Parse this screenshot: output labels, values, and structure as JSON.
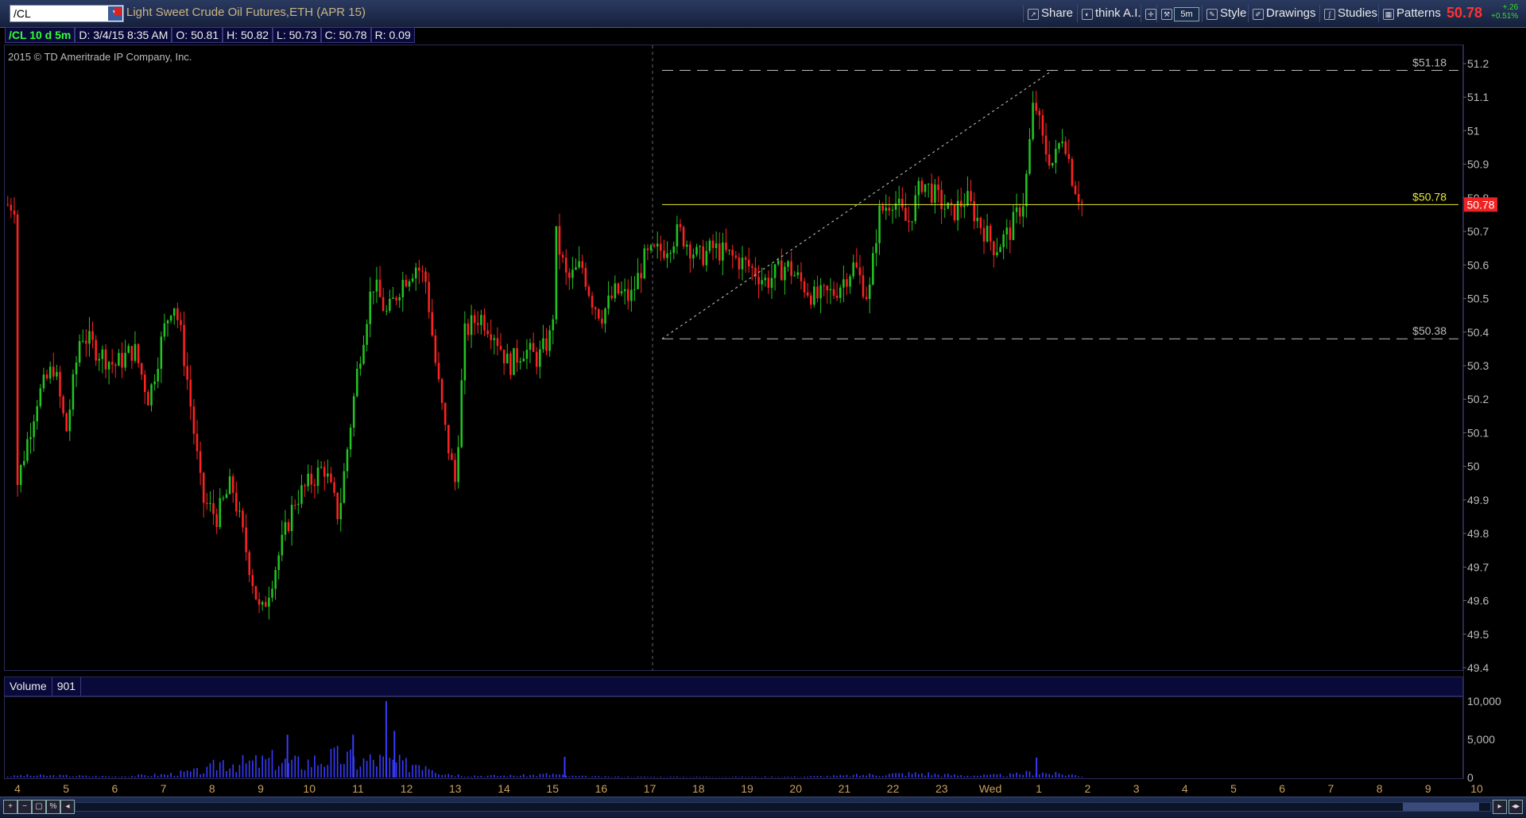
{
  "toolbar": {
    "symbol": "/CL",
    "title": "Light Sweet Crude Oil Futures,ETH (APR 15)",
    "share_label": "Share",
    "thinkai_label": "think A.I.",
    "interval_label": "5m",
    "style_label": "Style",
    "drawings_label": "Drawings",
    "studies_label": "Studies",
    "patterns_label": "Patterns",
    "last_price": "50.78",
    "change": "+.26",
    "change_pct": "+0.51%"
  },
  "info": {
    "symbol_period": "/CL 10 d 5m",
    "date": "D: 3/4/15 8:35 AM",
    "open": "O: 50.81",
    "high": "H: 50.82",
    "low": "L: 50.73",
    "close": "C: 50.78",
    "range": "R: 0.09"
  },
  "copyright": "2015 © TD Ameritrade IP Company, Inc.",
  "volume_pane": {
    "label": "Volume",
    "value": "901"
  },
  "colors": {
    "up": "#22c422",
    "down": "#ff2222",
    "volume": "#3a3aff",
    "level_line": "#e8e832",
    "dash_line": "#bbbbbb",
    "price_tag_bg": "#ee2222"
  },
  "chart_data": {
    "type": "candlestick",
    "price_axis": {
      "ticks": [
        "51.2",
        "51.1",
        "51",
        "50.9",
        "50.8",
        "50.7",
        "50.6",
        "50.5",
        "50.4",
        "50.3",
        "50.2",
        "50.1",
        "50",
        "49.9",
        "49.8",
        "49.7",
        "49.6",
        "49.5",
        "49.4"
      ],
      "ylim": [
        49.4,
        51.2
      ]
    },
    "volume_axis": {
      "ticks": [
        "10,000",
        "5,000",
        "0"
      ],
      "ylim": [
        0,
        10000
      ]
    },
    "x_labels": [
      "4",
      "5",
      "6",
      "7",
      "8",
      "9",
      "10",
      "11",
      "12",
      "13",
      "14",
      "15",
      "16",
      "17",
      "18",
      "19",
      "20",
      "21",
      "22",
      "23",
      "Wed",
      "1",
      "2",
      "3",
      "4",
      "5",
      "6",
      "7",
      "8",
      "9",
      "10"
    ],
    "levels": [
      {
        "label": "$51.18",
        "value": 51.18,
        "style": "dashed"
      },
      {
        "label": "$50.78",
        "value": 50.78,
        "style": "solid"
      },
      {
        "label": "$50.38",
        "value": 50.38,
        "style": "dashed"
      }
    ],
    "current_price_tag": "50.78",
    "trendline": {
      "from_value": 50.38,
      "to_value": 51.18
    },
    "close_anchors": [
      [
        0,
        49.95
      ],
      [
        0.4,
        50.2
      ],
      [
        0.75,
        50.3
      ],
      [
        1.0,
        50.1
      ],
      [
        1.3,
        50.4
      ],
      [
        1.6,
        50.35
      ],
      [
        2.0,
        50.3
      ],
      [
        2.4,
        50.35
      ],
      [
        2.7,
        50.2
      ],
      [
        3.0,
        50.4
      ],
      [
        3.2,
        50.5
      ],
      [
        3.35,
        50.4
      ],
      [
        3.5,
        50.25
      ],
      [
        3.8,
        49.9
      ],
      [
        4.1,
        49.85
      ],
      [
        4.4,
        49.95
      ],
      [
        4.7,
        49.75
      ],
      [
        5.0,
        49.55
      ],
      [
        5.3,
        49.7
      ],
      [
        5.7,
        49.9
      ],
      [
        6.0,
        49.95
      ],
      [
        6.3,
        50.0
      ],
      [
        6.6,
        49.85
      ],
      [
        7.0,
        50.3
      ],
      [
        7.3,
        50.55
      ],
      [
        7.6,
        50.45
      ],
      [
        7.9,
        50.55
      ],
      [
        8.2,
        50.6
      ],
      [
        8.4,
        50.55
      ],
      [
        8.6,
        50.3
      ],
      [
        8.8,
        50.1
      ],
      [
        9.0,
        49.95
      ],
      [
        9.2,
        50.4
      ],
      [
        9.5,
        50.45
      ],
      [
        9.8,
        50.4
      ],
      [
        10.1,
        50.3
      ],
      [
        10.4,
        50.35
      ],
      [
        10.7,
        50.32
      ],
      [
        11.0,
        50.4
      ],
      [
        11.05,
        50.7
      ],
      [
        11.3,
        50.55
      ],
      [
        11.6,
        50.6
      ],
      [
        11.8,
        50.5
      ],
      [
        12.0,
        50.45
      ],
      [
        12.3,
        50.52
      ],
      [
        12.6,
        50.5
      ],
      [
        12.9,
        50.62
      ],
      [
        13.3,
        50.65
      ],
      [
        13.6,
        50.7
      ],
      [
        14.0,
        50.62
      ],
      [
        14.3,
        50.65
      ],
      [
        14.6,
        50.63
      ],
      [
        15.0,
        50.6
      ],
      [
        15.4,
        50.55
      ],
      [
        15.8,
        50.6
      ],
      [
        16.1,
        50.55
      ],
      [
        16.4,
        50.5
      ],
      [
        16.8,
        50.52
      ],
      [
        17.2,
        50.6
      ],
      [
        17.5,
        50.5
      ],
      [
        17.7,
        50.75
      ],
      [
        18.0,
        50.8
      ],
      [
        18.3,
        50.72
      ],
      [
        18.6,
        50.85
      ],
      [
        18.9,
        50.8
      ],
      [
        19.2,
        50.75
      ],
      [
        19.5,
        50.8
      ],
      [
        19.8,
        50.72
      ],
      [
        20.1,
        50.65
      ],
      [
        20.4,
        50.7
      ],
      [
        20.7,
        50.8
      ],
      [
        20.9,
        51.1
      ],
      [
        21.1,
        50.95
      ],
      [
        21.3,
        50.9
      ],
      [
        21.5,
        51.0
      ],
      [
        21.7,
        50.85
      ],
      [
        21.9,
        50.78
      ]
    ],
    "volume_anchors": [
      [
        0,
        300
      ],
      [
        1,
        250
      ],
      [
        2,
        150
      ],
      [
        3,
        400
      ],
      [
        3.9,
        1000
      ],
      [
        4.2,
        2400
      ],
      [
        4.6,
        2000
      ],
      [
        5.0,
        2200
      ],
      [
        5.3,
        2600
      ],
      [
        5.6,
        2000
      ],
      [
        6.0,
        2300
      ],
      [
        6.4,
        2800
      ],
      [
        6.7,
        3000
      ],
      [
        7.0,
        2200
      ],
      [
        7.3,
        2600
      ],
      [
        7.6,
        2400
      ],
      [
        8.0,
        1800
      ],
      [
        8.3,
        2500
      ],
      [
        8.5,
        2000
      ],
      [
        8.7,
        800
      ],
      [
        9.0,
        400
      ],
      [
        9.5,
        250
      ],
      [
        10.0,
        250
      ],
      [
        10.5,
        300
      ],
      [
        11.0,
        500
      ],
      [
        11.3,
        200
      ],
      [
        12.0,
        120
      ],
      [
        13.0,
        100
      ],
      [
        14.0,
        100
      ],
      [
        15.0,
        100
      ],
      [
        16.0,
        120
      ],
      [
        17.0,
        250
      ],
      [
        17.5,
        400
      ],
      [
        18.0,
        500
      ],
      [
        18.6,
        600
      ],
      [
        19.0,
        400
      ],
      [
        19.5,
        300
      ],
      [
        20.0,
        300
      ],
      [
        20.5,
        400
      ],
      [
        20.9,
        800
      ],
      [
        21.3,
        500
      ],
      [
        21.7,
        400
      ],
      [
        21.9,
        200
      ]
    ],
    "volume_spikes": [
      [
        7.58,
        10000
      ],
      [
        6.9,
        5600
      ],
      [
        5.55,
        5600
      ],
      [
        11.25,
        2700
      ],
      [
        20.95,
        2600
      ],
      [
        7.75,
        6100
      ]
    ]
  }
}
